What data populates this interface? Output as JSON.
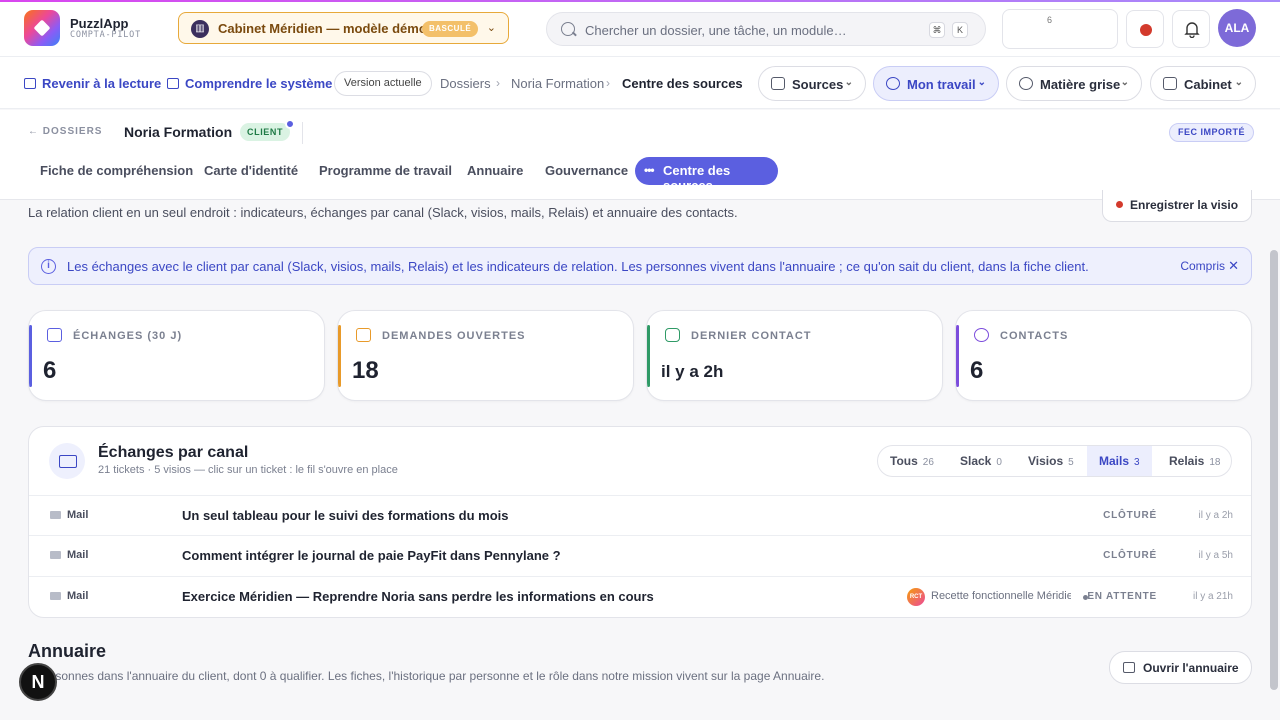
{
  "header": {
    "brand": "PuzzlApp",
    "brand_sub": "COMPTA-PILOT",
    "cabinet_label": "Cabinet Méridien — modèle démo",
    "cabinet_badge": "BASCULÉ",
    "search_placeholder": "Chercher un dossier, une tâche, un module…",
    "kbd_1": "⌘",
    "kbd_2": "K",
    "box_value": "6",
    "avatar": "ALA"
  },
  "nav": {
    "back_reading": "Revenir à la lecture",
    "understand": "Comprendre le système",
    "version": "Version actuelle",
    "breadcrumb": [
      "Dossiers",
      "Noria Formation",
      "Centre des sources"
    ],
    "pills": [
      "Sources",
      "Mon travail",
      "Matière grise",
      "Cabinet"
    ]
  },
  "dossier": {
    "back": "DOSSIERS",
    "name": "Noria Formation",
    "badge": "CLIENT",
    "fec": "FEC IMPORTÉ",
    "tabs": [
      "Fiche de compréhension",
      "Carte d'identité",
      "Programme de travail",
      "Annuaire",
      "Gouvernance"
    ],
    "active_tab": "Centre des sources"
  },
  "main": {
    "intro": "La relation client en un seul endroit : indicateurs, échanges par canal (Slack, visios, mails, Relais) et annuaire des contacts.",
    "record_visio": "Enregistrer la visio",
    "info_text": "Les échanges avec le client par canal (Slack, visios, mails, Relais) et les indicateurs de relation. Les personnes vivent dans l'annuaire ; ce qu'on sait du client, dans la fiche client.",
    "info_close": "Compris"
  },
  "kpis": [
    {
      "label": "ÉCHANGES (30 J)",
      "value": "6",
      "color": "#5b5fe0"
    },
    {
      "label": "DEMANDES OUVERTES",
      "value": "18",
      "color": "#e89a2a"
    },
    {
      "label": "DERNIER CONTACT",
      "value": "il y a 2h",
      "color": "#2f9a66"
    },
    {
      "label": "CONTACTS",
      "value": "6",
      "color": "#7c4ddc"
    }
  ],
  "exchanges": {
    "title": "Échanges par canal",
    "subtitle": "21 tickets · 5 visios — clic sur un ticket : le fil s'ouvre en place",
    "filters": [
      {
        "label": "Tous",
        "count": "26"
      },
      {
        "label": "Slack",
        "count": "0"
      },
      {
        "label": "Visios",
        "count": "5"
      },
      {
        "label": "Mails",
        "count": "3"
      },
      {
        "label": "Relais",
        "count": "18"
      }
    ],
    "rows": [
      {
        "channel": "Mail",
        "subject": "Un seul tableau pour le suivi des formations du mois",
        "status": "CLÔTURÉ",
        "time": "il y a 2h"
      },
      {
        "channel": "Mail",
        "subject": "Comment intégrer le journal de paie PayFit dans Pennylane ?",
        "status": "CLÔTURÉ",
        "time": "il y a 5h"
      },
      {
        "channel": "Mail",
        "subject": "Exercice Méridien — Reprendre Noria sans perdre les informations en cours",
        "owner_initials": "RCT",
        "owner": "Recette fonctionnelle Méridien",
        "status": "EN ATTENTE",
        "time": "il y a 21h"
      }
    ]
  },
  "annuaire": {
    "title": "Annuaire",
    "subtitle": "6 personnes dans l'annuaire du client, dont 0 à qualifier. Les fiches, l'historique par personne et le rôle dans notre mission vivent sur la page Annuaire.",
    "open": "Ouvrir l'annuaire"
  },
  "floating": {
    "n": "N"
  }
}
